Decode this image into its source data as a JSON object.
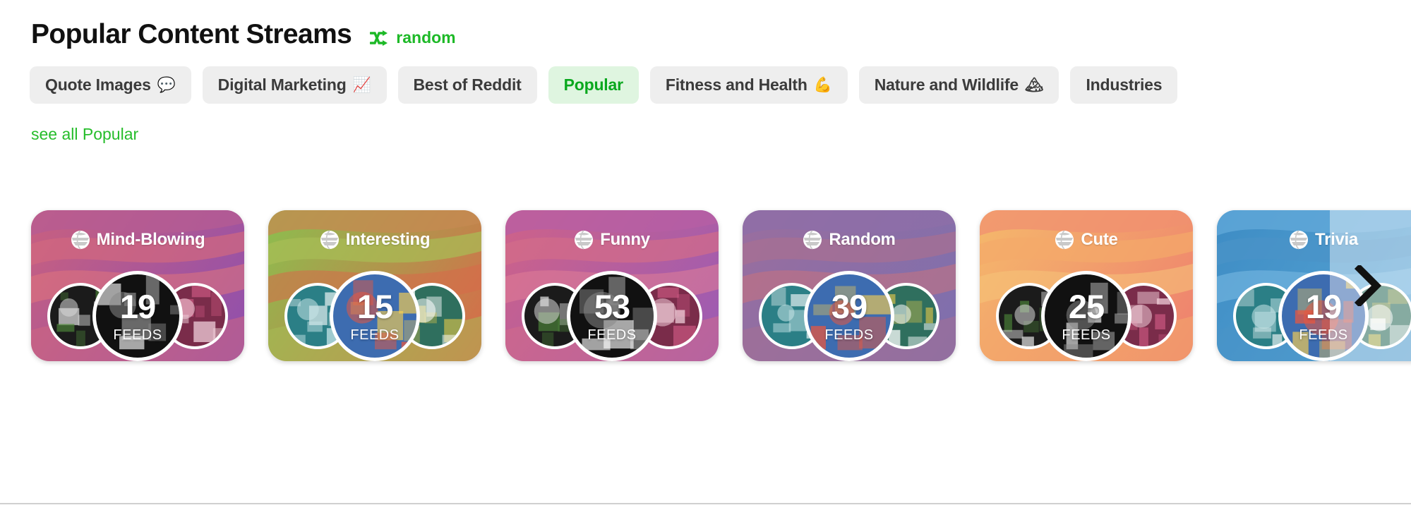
{
  "header": {
    "title": "Popular Content Streams",
    "random_label": "random",
    "random_icon": "shuffle-icon",
    "accent_green": "#1db927"
  },
  "tabs": [
    {
      "label": "Quote Images",
      "emoji": "💬",
      "active": false
    },
    {
      "label": "Digital Marketing",
      "emoji": "📈",
      "active": false
    },
    {
      "label": "Best of Reddit",
      "emoji": "",
      "active": false
    },
    {
      "label": "Popular",
      "emoji": "",
      "active": true
    },
    {
      "label": "Fitness and Health",
      "emoji": "💪",
      "active": false
    },
    {
      "label": "Nature and Wildlife",
      "emoji": "🏔",
      "active": false
    },
    {
      "label": "Industries",
      "emoji": "",
      "active": false
    }
  ],
  "see_all": {
    "label": "see all Popular"
  },
  "cards": [
    {
      "title": "Mind-Blowing",
      "count": "19",
      "feeds_label": "FEEDS",
      "gradient_from": "#c9607f",
      "gradient_to": "#8e4fae",
      "wave_a": "#d2687f",
      "wave_b": "#b55c93",
      "wave_c": "#e0757c",
      "left_avatar": "lh-logo",
      "center_avatar": "cloud-head-photo",
      "right_avatar": "gopro-logo"
    },
    {
      "title": "Interesting",
      "count": "15",
      "feeds_label": "FEEDS",
      "gradient_from": "#8bbf4e",
      "gradient_to": "#d9694a",
      "wave_a": "#a8bd55",
      "wave_b": "#c58a52",
      "wave_c": "#d76a4b",
      "left_avatar": "fs-logo",
      "center_avatar": "laughing-squid-logo",
      "right_avatar": "retro-runner-logo"
    },
    {
      "title": "Funny",
      "count": "53",
      "feeds_label": "FEEDS",
      "gradient_from": "#cf6288",
      "gradient_to": "#9a5bb5",
      "wave_a": "#d36c89",
      "wave_b": "#b75fa4",
      "wave_c": "#e07e95",
      "left_avatar": "ee-logo",
      "center_avatar": "troll-android-meme",
      "right_avatar": "cartoon-lady-avatar"
    },
    {
      "title": "Random",
      "count": "39",
      "feeds_label": "FEEDS",
      "gradient_from": "#9a6e9e",
      "gradient_to": "#7d6fae",
      "wave_a": "#a86f92",
      "wave_b": "#8e6fa8",
      "wave_c": "#c9737e",
      "left_avatar": "gopro-logo",
      "center_avatar": "earthshots-mosaic",
      "right_avatar": "design-foundation-seal"
    },
    {
      "title": "Cute",
      "count": "25",
      "feeds_label": "FEEDS",
      "gradient_from": "#f5b96b",
      "gradient_to": "#ee7f6e",
      "wave_a": "#f3aa6a",
      "wave_b": "#f09070",
      "wave_c": "#f6c57a",
      "left_avatar": "cute-cats-logo",
      "center_avatar": "cute-script-logo",
      "right_avatar": "bulldog-puppy-photo"
    },
    {
      "title": "Trivia",
      "count": "19",
      "feeds_label": "FEEDS",
      "gradient_from": "#3d8cc4",
      "gradient_to": "#5aa6d6",
      "wave_a": "#4a93c8",
      "wave_b": "#63aada",
      "wave_c": "#7bbbe4",
      "left_avatar": "color-wheel-smiley",
      "center_avatar": "trivia-dots",
      "right_avatar": "green-tile"
    }
  ],
  "carousel": {
    "next_icon": "chevron-right-icon"
  }
}
